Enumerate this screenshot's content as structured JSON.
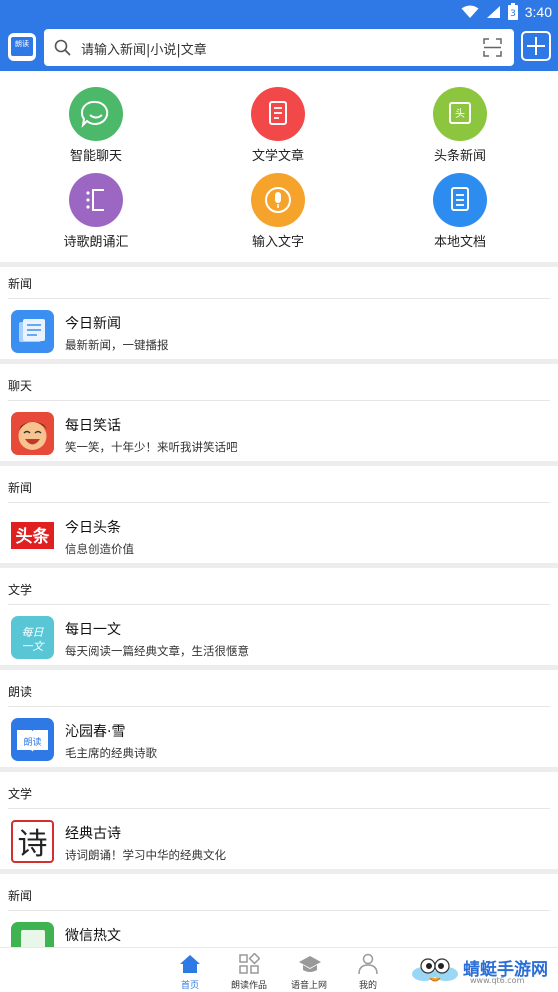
{
  "status_bar": {
    "time": "3:40",
    "battery_level": "3"
  },
  "header": {
    "logo_text": "朗读",
    "search_placeholder": "请输入新闻|小说|文章"
  },
  "grid": {
    "items": [
      {
        "label": "智能聊天",
        "icon": "chat-icon",
        "color": "#4cb86a"
      },
      {
        "label": "文学文章",
        "icon": "document-icon",
        "color": "#f2484a"
      },
      {
        "label": "头条新闻",
        "icon": "headline-icon",
        "color": "#8cc63f"
      },
      {
        "label": "诗歌朗诵汇",
        "icon": "list-icon",
        "color": "#9b67c2"
      },
      {
        "label": "输入文字",
        "icon": "microphone-icon",
        "color": "#f6a32c"
      },
      {
        "label": "本地文档",
        "icon": "file-icon",
        "color": "#2d8cf0"
      }
    ]
  },
  "sections": [
    {
      "category": "新闻",
      "title": "今日新闻",
      "subtitle": "最新新闻，一键播报",
      "thumb": "news-thumb"
    },
    {
      "category": "聊天",
      "title": "每日笑话",
      "subtitle": "笑一笑，十年少！来听我讲笑话吧",
      "thumb": "laughing-face-thumb"
    },
    {
      "category": "新闻",
      "title": "今日头条",
      "subtitle": "信息创造价值",
      "thumb": "toutiao-logo",
      "thumb_text": "头条"
    },
    {
      "category": "文学",
      "title": "每日一文",
      "subtitle": "每天阅读一篇经典文章，生活很惬意",
      "thumb": "one-article-thumb",
      "thumb_text": "每日一文"
    },
    {
      "category": "朗读",
      "title": "沁园春·雪",
      "subtitle": "毛主席的经典诗歌",
      "thumb": "read-book-thumb",
      "thumb_text": "朗读"
    },
    {
      "category": "文学",
      "title": "经典古诗",
      "subtitle": "诗词朗诵！学习中华的经典文化",
      "thumb": "poem-thumb",
      "thumb_text": "诗"
    },
    {
      "category": "新闻",
      "title": "微信热文",
      "subtitle": "",
      "thumb": "wechat-thumb"
    }
  ],
  "bottom_nav": {
    "items": [
      {
        "label": "首页",
        "icon": "home-icon",
        "active": true
      },
      {
        "label": "朗读作品",
        "icon": "works-icon",
        "active": false
      },
      {
        "label": "语音上网",
        "icon": "graduation-cap-icon",
        "active": false
      },
      {
        "label": "我的",
        "icon": "person-icon",
        "active": false
      }
    ]
  },
  "watermark": {
    "text": "蜻蜓手游网",
    "url": "www.qt6.com"
  },
  "colors": {
    "primary": "#2f79e6",
    "divider": "#ededed"
  }
}
